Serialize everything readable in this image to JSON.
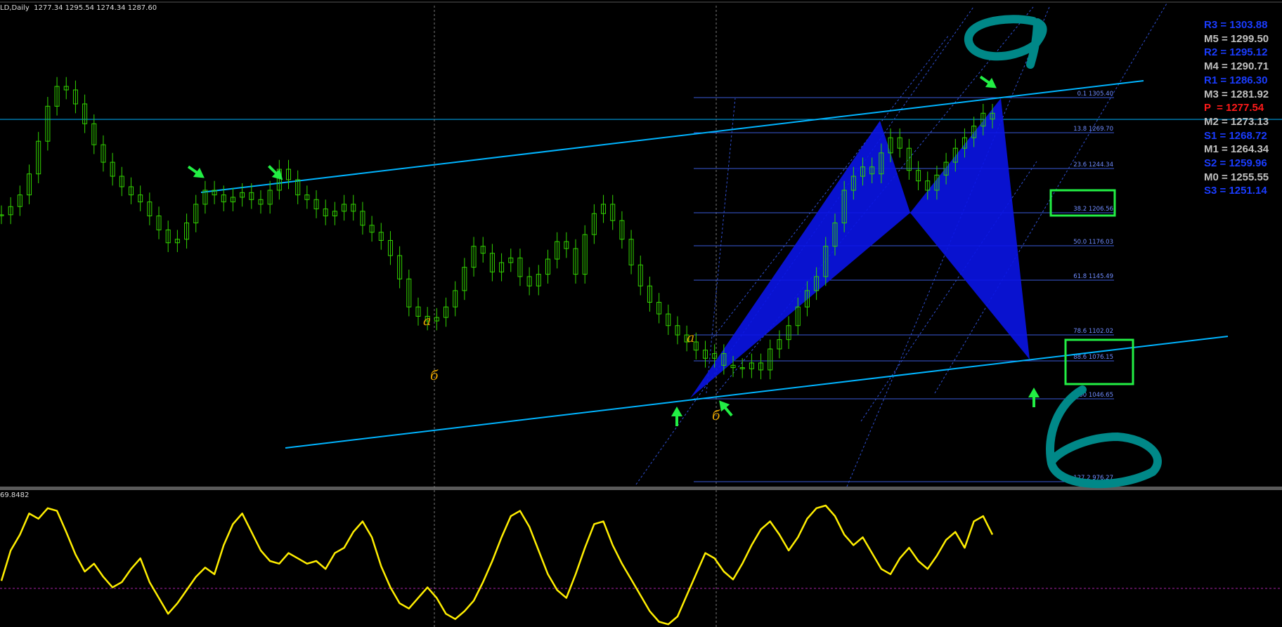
{
  "header": {
    "symbol": "LD,Daily",
    "ohlc": "1277.34 1295.54 1274.34 1287.60"
  },
  "indicator": {
    "value_label": "69.8482"
  },
  "pivot_levels": [
    {
      "name": "R3",
      "value": "1303.88",
      "color": "#1a3cff"
    },
    {
      "name": "M5",
      "value": "1299.50",
      "color": "#c0c0c0"
    },
    {
      "name": "R2",
      "value": "1295.12",
      "color": "#1a3cff"
    },
    {
      "name": "M4",
      "value": "1290.71",
      "color": "#c0c0c0"
    },
    {
      "name": "R1",
      "value": "1286.30",
      "color": "#1a3cff"
    },
    {
      "name": "M3",
      "value": "1281.92",
      "color": "#c0c0c0"
    },
    {
      "name": "P",
      "value": "1277.54",
      "color": "#ff1a1a"
    },
    {
      "name": "M2",
      "value": "1273.13",
      "color": "#c0c0c0"
    },
    {
      "name": "S1",
      "value": "1268.72",
      "color": "#1a3cff"
    },
    {
      "name": "M1",
      "value": "1264.34",
      "color": "#c0c0c0"
    },
    {
      "name": "S2",
      "value": "1259.96",
      "color": "#1a3cff"
    },
    {
      "name": "M0",
      "value": "1255.55",
      "color": "#c0c0c0"
    },
    {
      "name": "S3",
      "value": "1251.14",
      "color": "#1a3cff"
    }
  ],
  "wave_labels": {
    "a": "a",
    "b": "б"
  },
  "colors": {
    "background": "#000000",
    "candles": "#32d400",
    "channel": "#00b4ff",
    "harmonic_pattern": "#0a14e6",
    "fib_lines": "#3a5ad8",
    "indicator_line": "#ffee00",
    "arrows": "#22ee44",
    "target_boxes": "#22ee44",
    "hand_drawn_marks": "#008888",
    "wave_labels": "#e0a000"
  },
  "chart_data": {
    "type": "line",
    "title": "",
    "xlabel": "",
    "ylabel": "",
    "fibonacci_levels": [
      {
        "ratio": "0.1",
        "price": "1305.40"
      },
      {
        "ratio": "13.8",
        "price": "1269.70"
      },
      {
        "ratio": "23.6",
        "price": "1244.34"
      },
      {
        "ratio": "38.2",
        "price": "1206.56"
      },
      {
        "ratio": "50.0",
        "price": "1176.03"
      },
      {
        "ratio": "61.8",
        "price": "1145.49"
      },
      {
        "ratio": "78.6",
        "price": "1102.02"
      },
      {
        "ratio": "88.6",
        "price": "1076.15"
      },
      {
        "ratio": "100",
        "price": "1046.65"
      },
      {
        "ratio": "127.2",
        "price": "976.27"
      }
    ],
    "price_series": [
      1205,
      1212,
      1222,
      1240,
      1268,
      1298,
      1315,
      1312,
      1300,
      1283,
      1265,
      1250,
      1238,
      1229,
      1222,
      1216,
      1204,
      1192,
      1181,
      1184,
      1198,
      1214,
      1226,
      1222,
      1216,
      1220,
      1224,
      1218,
      1214,
      1226,
      1244,
      1235,
      1222,
      1218,
      1210,
      1204,
      1208,
      1214,
      1208,
      1196,
      1190,
      1183,
      1170,
      1150,
      1126,
      1118,
      1114,
      1117,
      1126,
      1140,
      1160,
      1178,
      1172,
      1156,
      1164,
      1168,
      1152,
      1144,
      1154,
      1167,
      1182,
      1176,
      1154,
      1188,
      1206,
      1214,
      1200,
      1184,
      1162,
      1144,
      1130,
      1120,
      1110,
      1102,
      1096,
      1089,
      1082,
      1086,
      1076,
      1074,
      1073,
      1078,
      1072,
      1090,
      1098,
      1110,
      1126,
      1140,
      1152,
      1178,
      1198,
      1226,
      1238,
      1246,
      1240,
      1258,
      1271,
      1262,
      1243,
      1234,
      1226,
      1239,
      1250,
      1262,
      1271,
      1281,
      1292,
      1287
    ],
    "oscillator_series": [
      35,
      58,
      70,
      86,
      82,
      90,
      88,
      72,
      55,
      42,
      48,
      38,
      30,
      34,
      44,
      52,
      34,
      22,
      10,
      18,
      28,
      38,
      45,
      40,
      62,
      78,
      86,
      72,
      58,
      50,
      48,
      56,
      52,
      48,
      50,
      44,
      56,
      60,
      72,
      80,
      68,
      46,
      30,
      18,
      14,
      22,
      30,
      22,
      10,
      6,
      12,
      20,
      34,
      50,
      68,
      84,
      88,
      76,
      58,
      40,
      28,
      22,
      40,
      60,
      78,
      80,
      62,
      48,
      36,
      24,
      12,
      4,
      2,
      8,
      24,
      40,
      56,
      52,
      42,
      36,
      48,
      62,
      74,
      80,
      70,
      58,
      68,
      82,
      90,
      92,
      84,
      70,
      62,
      68,
      56,
      44,
      40,
      52,
      60,
      50,
      44,
      54,
      66,
      72,
      60,
      80,
      84,
      70
    ]
  }
}
